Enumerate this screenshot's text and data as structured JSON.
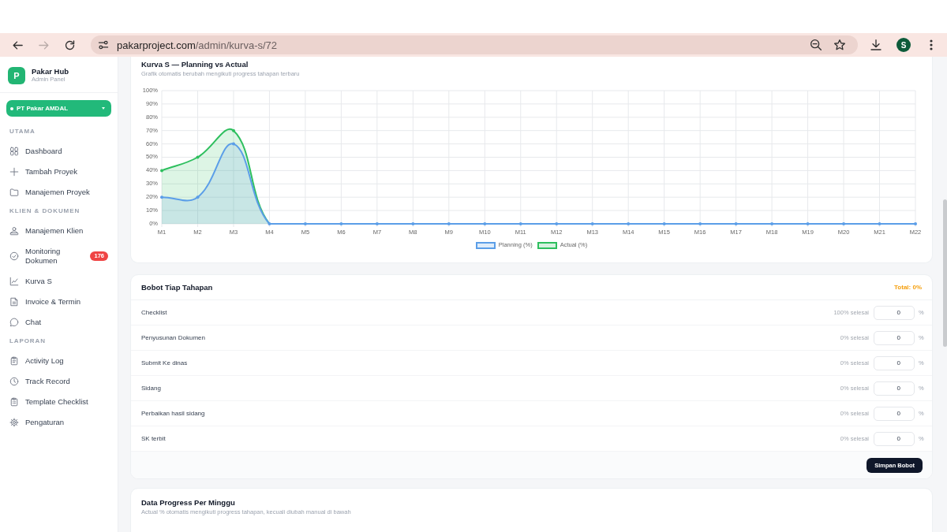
{
  "browser": {
    "back": {
      "disabled": false
    },
    "forward": {
      "disabled": true
    },
    "url_host": "pakarproject.com",
    "url_path": "/admin/kurva-s/72",
    "profile": "S"
  },
  "sidebar": {
    "brand": {
      "logo": "P",
      "name": "Pakar Hub",
      "subtitle": "Admin Panel"
    },
    "project_selector": "PT Pakar AMDAL",
    "sections": [
      {
        "title": "UTAMA",
        "items": [
          {
            "label": "Dashboard",
            "selected": false
          },
          {
            "label": "Tambah Proyek",
            "selected": false
          },
          {
            "label": "Manajemen Proyek",
            "selected": false
          }
        ]
      },
      {
        "title": "KLIEN & DOKUMEN",
        "items": [
          {
            "label": "Manajemen Klien",
            "selected": false
          },
          {
            "label": "Monitoring Dokumen",
            "badge": "176",
            "selected": false
          },
          {
            "label": "Kurva S",
            "selected": false
          },
          {
            "label": "Invoice & Termin",
            "selected": false
          },
          {
            "label": "Chat",
            "selected": false
          }
        ]
      },
      {
        "title": "LAPORAN",
        "items": [
          {
            "label": "Activity Log",
            "selected": false
          },
          {
            "label": "Track Record",
            "selected": false
          },
          {
            "label": "Template Checklist",
            "selected": false
          },
          {
            "label": "Pengaturan",
            "selected": false
          }
        ]
      }
    ]
  },
  "kurva_s": {
    "title": "Kurva S — Planning vs Actual",
    "subtitle": "Grafik otomatis berubah mengikuti progress tahapan terbaru",
    "chart_data": {
      "type": "area",
      "grid": true,
      "legend": true,
      "categories": [
        "M1",
        "M2",
        "M3",
        "M4",
        "M5",
        "M6",
        "M7",
        "M8",
        "M9",
        "M10",
        "M11",
        "M12",
        "M13",
        "M14",
        "M15",
        "M16",
        "M17",
        "M18",
        "M19",
        "M20",
        "M21",
        "M22"
      ],
      "series": [
        {
          "name": "Planning (%)",
          "color": "#5b9ee8",
          "values": [
            20,
            20,
            60,
            0,
            0,
            0,
            0,
            0,
            0,
            0,
            0,
            0,
            0,
            0,
            0,
            0,
            0,
            0,
            0,
            0,
            0,
            0
          ]
        },
        {
          "name": "Actual (%)",
          "color": "#2ebf5e",
          "values": [
            40,
            50,
            70,
            0,
            0,
            0,
            0,
            0,
            0,
            0,
            0,
            0,
            0,
            0,
            0,
            0,
            0,
            0,
            0,
            0,
            0,
            0
          ]
        }
      ],
      "ylim": [
        0,
        100
      ],
      "yticks": [
        {
          "value": 0,
          "label": "0%"
        },
        {
          "value": 10,
          "label": "10%"
        },
        {
          "value": 20,
          "label": "20%"
        },
        {
          "value": 30,
          "label": "30%"
        },
        {
          "value": 40,
          "label": "40%"
        },
        {
          "value": 50,
          "label": "50%"
        },
        {
          "value": 60,
          "label": "60%"
        },
        {
          "value": 70,
          "label": "70%"
        },
        {
          "value": 80,
          "label": "80%"
        },
        {
          "value": 90,
          "label": "90%"
        },
        {
          "value": 100,
          "label": "100%"
        }
      ]
    }
  },
  "bobot": {
    "title": "Bobot Tiap Tahapan",
    "total": "Total: 0%",
    "stages": [
      {
        "name": "Checklist",
        "progress": "100% selesai",
        "weight": "0",
        "unit": "%"
      },
      {
        "name": "Penyusunan Dokumen",
        "progress": "0% selesai",
        "weight": "0",
        "unit": "%"
      },
      {
        "name": "Submit Ke dinas",
        "progress": "0% selesai",
        "weight": "0",
        "unit": "%"
      },
      {
        "name": "Sidang",
        "progress": "0% selesai",
        "weight": "0",
        "unit": "%"
      },
      {
        "name": "Perbaikan hasil sidang",
        "progress": "0% selesai",
        "weight": "0",
        "unit": "%"
      },
      {
        "name": "SK terbit",
        "progress": "0% selesai",
        "weight": "0",
        "unit": "%"
      }
    ],
    "save_button": "Simpan Bobot"
  },
  "weekly_progress": {
    "title": "Data Progress Per Minggu",
    "subtitle": "Actual % otomatis mengikuti progress tahapan, kecuali diubah manual di bawah"
  }
}
